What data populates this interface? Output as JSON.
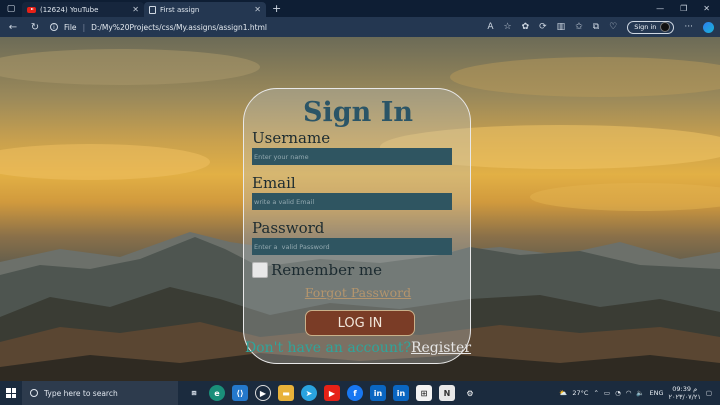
{
  "browser": {
    "tabs": [
      {
        "title": "(12624) YouTube",
        "icon": "youtube-icon",
        "active": false
      },
      {
        "title": "First assign",
        "icon": "page-icon",
        "active": true
      }
    ],
    "address": {
      "file_label": "File",
      "url": "D:/My%20Projects/css/My.assigns/assign1.html"
    },
    "signin_label": "Sign in"
  },
  "form": {
    "title": "Sign In",
    "username": {
      "label": "Username",
      "placeholder": "Enter your name"
    },
    "email": {
      "label": "Email",
      "placeholder": "write a valid Email"
    },
    "password": {
      "label": "Password",
      "placeholder": "Enter a  valid Password"
    },
    "remember_label": "Remember me",
    "forgot_label": "Forgot Password",
    "login_label": "LOG IN",
    "no_account_text": "Don't have an account?",
    "register_label": "Register"
  },
  "taskbar": {
    "search_placeholder": "Type here to search",
    "weather": "27°C",
    "language": "ENG",
    "time": "09:39 م",
    "date": "٢٠٢٣/٠٧/٢١"
  },
  "colors": {
    "title": "#2b5567",
    "input_bg": "#2f5561",
    "login_bg": "#7a3c26",
    "forgot_link": "#b4956d",
    "no_account": "#2fa59b"
  }
}
